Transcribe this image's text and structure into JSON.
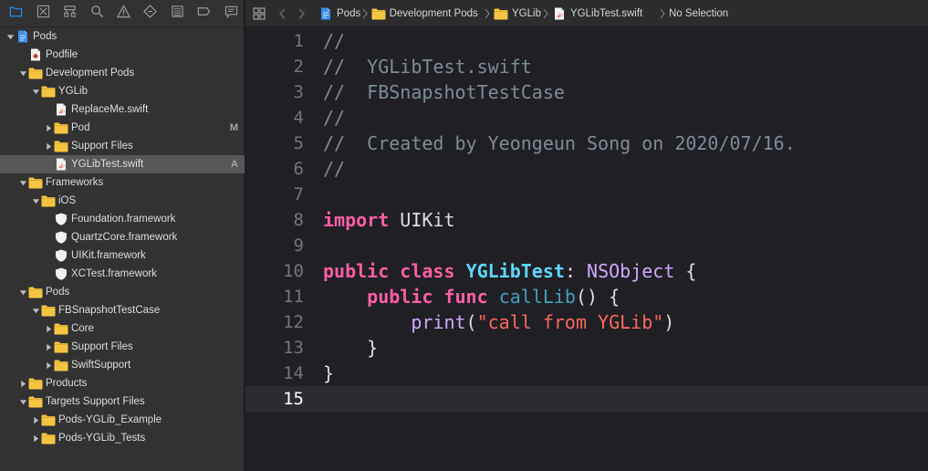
{
  "navigator": {
    "toolbar": [
      {
        "name": "project-navigator-icon",
        "selected": true
      },
      {
        "name": "source-control-navigator-icon"
      },
      {
        "name": "symbol-navigator-icon"
      },
      {
        "name": "find-navigator-icon"
      },
      {
        "name": "issue-navigator-icon"
      },
      {
        "name": "test-navigator-icon"
      },
      {
        "name": "debug-navigator-icon"
      },
      {
        "name": "breakpoint-navigator-icon"
      },
      {
        "name": "report-navigator-icon"
      }
    ],
    "items": [
      {
        "label": "Pods",
        "depth": 0,
        "disclosure": "open",
        "icon": "project-icon"
      },
      {
        "label": "Podfile",
        "depth": 1,
        "disclosure": "none",
        "icon": "ruby-file-icon"
      },
      {
        "label": "Development Pods",
        "depth": 1,
        "disclosure": "open",
        "icon": "folder-icon"
      },
      {
        "label": "YGLib",
        "depth": 2,
        "disclosure": "open",
        "icon": "folder-icon"
      },
      {
        "label": "ReplaceMe.swift",
        "depth": 3,
        "disclosure": "none",
        "icon": "swift-file-icon"
      },
      {
        "label": "Pod",
        "depth": 3,
        "disclosure": "closed",
        "icon": "folder-icon",
        "badge": "M"
      },
      {
        "label": "Support Files",
        "depth": 3,
        "disclosure": "closed",
        "icon": "folder-icon"
      },
      {
        "label": "YGLibTest.swift",
        "depth": 3,
        "disclosure": "none",
        "icon": "swift-file-icon",
        "badge": "A",
        "selected": true
      },
      {
        "label": "Frameworks",
        "depth": 1,
        "disclosure": "open",
        "icon": "folder-icon"
      },
      {
        "label": "iOS",
        "depth": 2,
        "disclosure": "open",
        "icon": "folder-icon"
      },
      {
        "label": "Foundation.framework",
        "depth": 3,
        "disclosure": "none",
        "icon": "framework-icon"
      },
      {
        "label": "QuartzCore.framework",
        "depth": 3,
        "disclosure": "none",
        "icon": "framework-icon"
      },
      {
        "label": "UIKit.framework",
        "depth": 3,
        "disclosure": "none",
        "icon": "framework-icon"
      },
      {
        "label": "XCTest.framework",
        "depth": 3,
        "disclosure": "none",
        "icon": "framework-icon"
      },
      {
        "label": "Pods",
        "depth": 1,
        "disclosure": "open",
        "icon": "folder-icon"
      },
      {
        "label": "FBSnapshotTestCase",
        "depth": 2,
        "disclosure": "open",
        "icon": "folder-icon"
      },
      {
        "label": "Core",
        "depth": 3,
        "disclosure": "closed",
        "icon": "folder-icon"
      },
      {
        "label": "Support Files",
        "depth": 3,
        "disclosure": "closed",
        "icon": "folder-icon"
      },
      {
        "label": "SwiftSupport",
        "depth": 3,
        "disclosure": "closed",
        "icon": "folder-icon"
      },
      {
        "label": "Products",
        "depth": 1,
        "disclosure": "closed",
        "icon": "folder-icon"
      },
      {
        "label": "Targets Support Files",
        "depth": 1,
        "disclosure": "open",
        "icon": "folder-icon"
      },
      {
        "label": "Pods-YGLib_Example",
        "depth": 2,
        "disclosure": "closed",
        "icon": "folder-icon"
      },
      {
        "label": "Pods-YGLib_Tests",
        "depth": 2,
        "disclosure": "closed",
        "icon": "folder-icon"
      }
    ]
  },
  "jumpbar": {
    "crumbs": [
      {
        "label": "Pods",
        "icon": "project-icon"
      },
      {
        "label": "Development Pods",
        "icon": "folder-icon"
      },
      {
        "label": "YGLib",
        "icon": "folder-icon"
      },
      {
        "label": "YGLibTest.swift",
        "icon": "swift-file-icon"
      },
      {
        "label": "No Selection",
        "icon": ""
      }
    ]
  },
  "editor": {
    "current_line": 15,
    "lines": [
      {
        "num": "1",
        "tokens": [
          {
            "t": "comment",
            "v": "//"
          }
        ]
      },
      {
        "num": "2",
        "tokens": [
          {
            "t": "comment",
            "v": "//  YGLibTest.swift"
          }
        ]
      },
      {
        "num": "3",
        "tokens": [
          {
            "t": "comment",
            "v": "//  FBSnapshotTestCase"
          }
        ]
      },
      {
        "num": "4",
        "tokens": [
          {
            "t": "comment",
            "v": "//"
          }
        ]
      },
      {
        "num": "5",
        "tokens": [
          {
            "t": "comment",
            "v": "//  Created by Yeongeun Song on 2020/07/16."
          }
        ]
      },
      {
        "num": "6",
        "tokens": [
          {
            "t": "comment",
            "v": "//"
          }
        ]
      },
      {
        "num": "7",
        "tokens": []
      },
      {
        "num": "8",
        "tokens": [
          {
            "t": "kw",
            "v": "import"
          },
          {
            "t": "plain",
            "v": " UIKit"
          }
        ]
      },
      {
        "num": "9",
        "tokens": []
      },
      {
        "num": "10",
        "tokens": [
          {
            "t": "kw",
            "v": "public"
          },
          {
            "t": "plain",
            "v": " "
          },
          {
            "t": "kw",
            "v": "class"
          },
          {
            "t": "plain",
            "v": " "
          },
          {
            "t": "type",
            "v": "YGLibTest"
          },
          {
            "t": "plain",
            "v": ": "
          },
          {
            "t": "sys",
            "v": "NSObject"
          },
          {
            "t": "plain",
            "v": " {"
          }
        ]
      },
      {
        "num": "11",
        "tokens": [
          {
            "t": "plain",
            "v": "    "
          },
          {
            "t": "kw",
            "v": "public"
          },
          {
            "t": "plain",
            "v": " "
          },
          {
            "t": "kw",
            "v": "func"
          },
          {
            "t": "plain",
            "v": " "
          },
          {
            "t": "fn",
            "v": "callLib"
          },
          {
            "t": "plain",
            "v": "() {"
          }
        ]
      },
      {
        "num": "12",
        "tokens": [
          {
            "t": "plain",
            "v": "        "
          },
          {
            "t": "sys",
            "v": "print"
          },
          {
            "t": "plain",
            "v": "("
          },
          {
            "t": "str",
            "v": "\"call from YGLib\""
          },
          {
            "t": "plain",
            "v": ")"
          }
        ]
      },
      {
        "num": "13",
        "tokens": [
          {
            "t": "plain",
            "v": "    }"
          }
        ]
      },
      {
        "num": "14",
        "tokens": [
          {
            "t": "plain",
            "v": "}"
          }
        ]
      },
      {
        "num": "15",
        "tokens": []
      }
    ]
  },
  "colors": {
    "folder": "#f5c542",
    "selected_tool": "#2f8cf7",
    "keyword": "#fc5fa3",
    "comment": "#7f8c98",
    "string": "#fc6a5d",
    "type_decl": "#5dd8ff",
    "system_type": "#d0a8ff",
    "function_decl": "#41a1c0"
  }
}
